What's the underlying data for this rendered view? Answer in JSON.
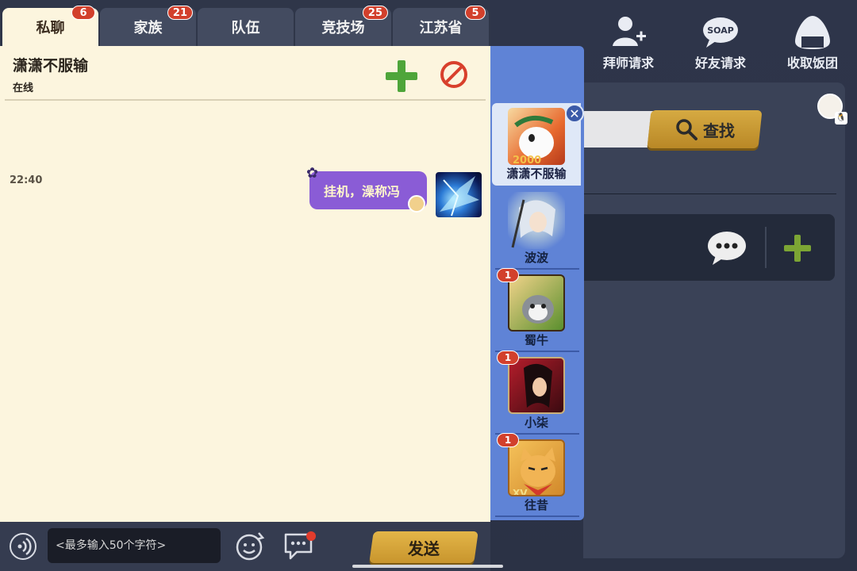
{
  "tabs": [
    {
      "label": "私聊",
      "badge": "6",
      "active": true
    },
    {
      "label": "家族",
      "badge": "21",
      "active": false
    },
    {
      "label": "队伍",
      "badge": "",
      "active": false
    },
    {
      "label": "竞技场",
      "badge": "25",
      "active": false
    },
    {
      "label": "江苏省",
      "badge": "5",
      "active": false
    }
  ],
  "contact": {
    "name": "潇潇不服输",
    "status": "在线"
  },
  "messages": [
    {
      "time": "22:40",
      "text": "挂机，澡称冯",
      "bubble_color": "#8a5cd6"
    }
  ],
  "input": {
    "placeholder": "<最多输入50个字符>",
    "send_label": "发送"
  },
  "conversations": [
    {
      "name": "潇潇不服输",
      "badge": "",
      "active": true
    },
    {
      "name": "波波",
      "badge": ""
    },
    {
      "name": "蜀牛",
      "badge": "1"
    },
    {
      "name": "小柒",
      "badge": "1"
    },
    {
      "name": "往昔",
      "badge": "1"
    }
  ],
  "top_actions": [
    {
      "label": "拜师请求",
      "icon": "mentor-request-icon"
    },
    {
      "label": "好友请求",
      "icon": "friend-request-icon"
    },
    {
      "label": "收取饭团",
      "icon": "rice-ball-icon"
    }
  ],
  "search": {
    "button_label": "查找"
  },
  "colors": {
    "chat_bg": "#fcf5de",
    "badge_red": "#d2402c",
    "list_blue": "#5f83d6",
    "gold_button": "#d6aa42"
  }
}
